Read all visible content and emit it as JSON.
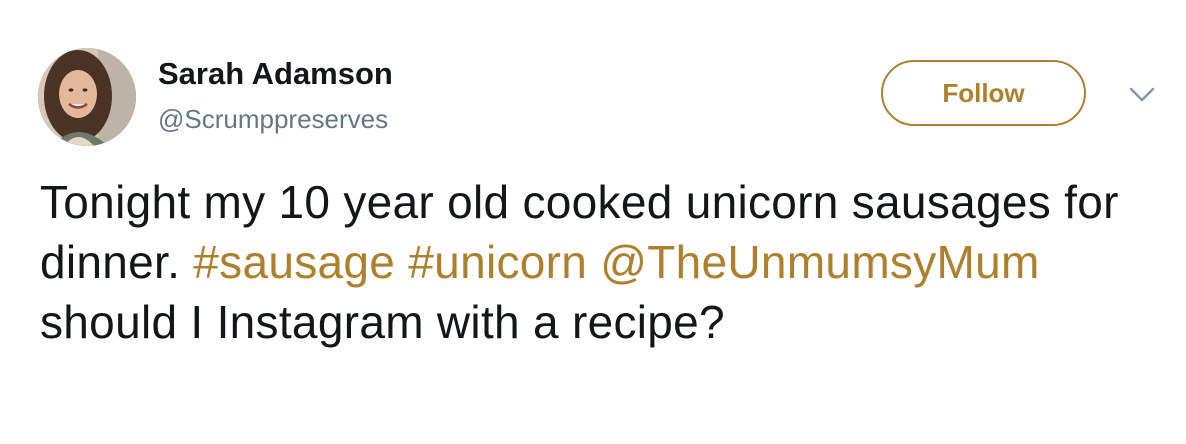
{
  "user": {
    "display_name": "Sarah Adamson",
    "handle": "@Scrumppreserves",
    "avatar_icon": "profile-photo"
  },
  "follow_button": {
    "label": "Follow"
  },
  "menu": {
    "icon": "chevron-down-icon"
  },
  "tweet": {
    "text_1": "Tonight my 10 year old cooked unicorn sausages for dinner. ",
    "hashtag_1": "#sausage",
    "text_2": " ",
    "hashtag_2": "#unicorn",
    "text_3": " ",
    "mention_1": "@TheUnmumsyMum",
    "text_4": " should I Instagram with a recipe?"
  },
  "colors": {
    "accent": "#b07f2c",
    "text": "#14171a",
    "secondary_text": "#657786",
    "chevron": "#8899a6"
  }
}
